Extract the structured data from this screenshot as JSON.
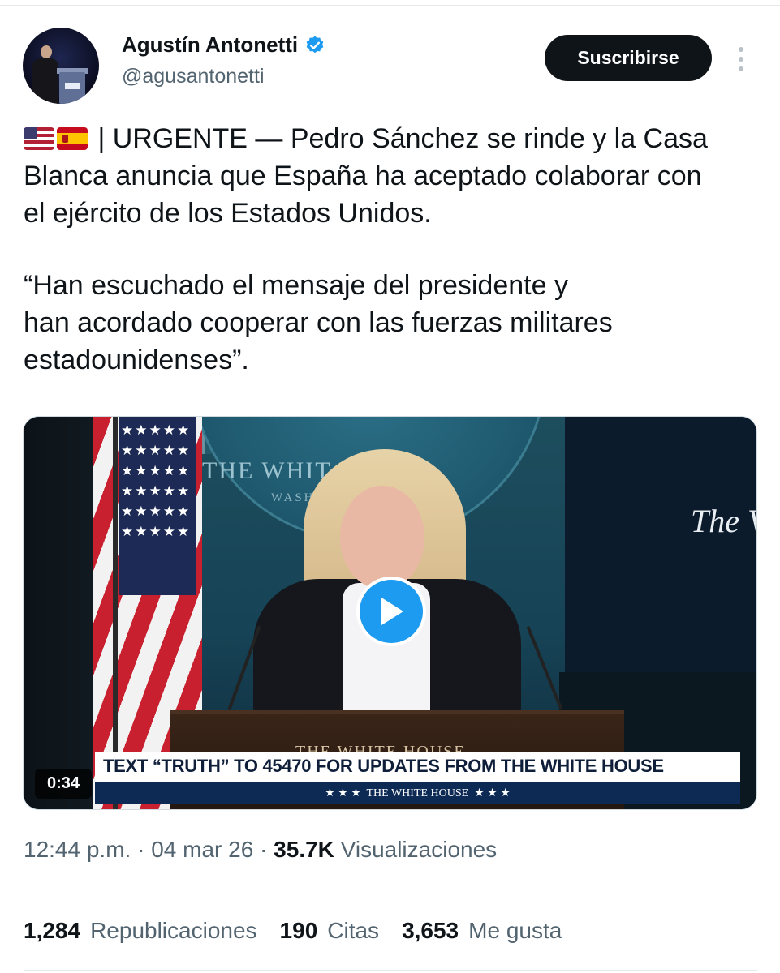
{
  "author": {
    "display_name": "Agustín Antonetti",
    "handle": "@agusantonetti",
    "verified": true,
    "verified_color": "#1d9bf0"
  },
  "actions": {
    "subscribe_label": "Suscribirse",
    "more_icon": "more-vertical-icon"
  },
  "tweet": {
    "flags": [
      "us-flag",
      "spain-flag"
    ],
    "lines": [
      " | URGENTE — Pedro Sánchez se rinde y la Casa",
      "Blanca anuncia que España ha aceptado colaborar con",
      "el ejército de los Estados Unidos.",
      "“Han escuchado el mensaje del presidente y",
      "han acordado cooperar con las fuerzas militares",
      "estadounidenses”."
    ]
  },
  "video": {
    "duration": "0:34",
    "banner_text": "TEXT “TRUTH” TO 45470 FOR UPDATES FROM THE WHITE HOUSE",
    "banner_sub": "★ ★ ★  THE WHITE HOUSE  ★ ★ ★",
    "seal_text": "THE WHIT   USE",
    "seal_sub": "WASH",
    "podium_text": "THE WHITE HOUSE",
    "right_sign": "The V",
    "flag_stars": "★★★★★★★★★★★★★★★★★★★★★★★★★★★★★★",
    "play_icon": "play-icon"
  },
  "meta": {
    "time": "12:44 p.m.",
    "date": "04 mar 26",
    "separator": " · ",
    "views_count": "35.7K",
    "views_label": "Visualizaciones"
  },
  "stats": {
    "reposts_count": "1,284",
    "reposts_label": "Republicaciones",
    "quotes_count": "190",
    "quotes_label": "Citas",
    "likes_count": "3,653",
    "likes_label": "Me gusta"
  }
}
